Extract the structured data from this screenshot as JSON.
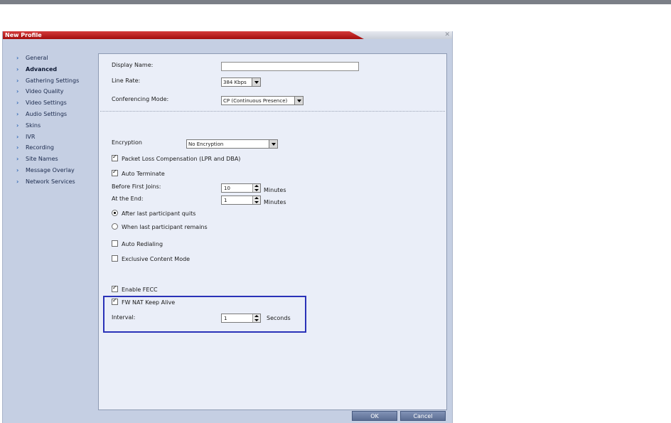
{
  "dialog": {
    "title": "New Profile"
  },
  "nav": {
    "items": [
      {
        "label": "General"
      },
      {
        "label": "Advanced"
      },
      {
        "label": "Gathering Settings"
      },
      {
        "label": "Video Quality"
      },
      {
        "label": "Video Settings"
      },
      {
        "label": "Audio Settings"
      },
      {
        "label": "Skins"
      },
      {
        "label": "IVR"
      },
      {
        "label": "Recording"
      },
      {
        "label": "Site Names"
      },
      {
        "label": "Message Overlay"
      },
      {
        "label": "Network Services"
      }
    ],
    "active": "Advanced"
  },
  "form": {
    "display_name": {
      "label": "Display Name:",
      "value": ""
    },
    "line_rate": {
      "label": "Line Rate:",
      "value": "384 Kbps"
    },
    "conferencing_mode": {
      "label": "Conferencing Mode:",
      "value": "CP (Continuous Presence)"
    },
    "encryption": {
      "label": "Encryption",
      "value": "No Encryption"
    },
    "packet_loss": {
      "label": "Packet Loss Compensation (LPR and DBA)",
      "checked": true
    },
    "auto_terminate": {
      "label": "Auto Terminate",
      "checked": true
    },
    "before_first_joins": {
      "label": "Before First Joins:",
      "value": "10",
      "unit": "Minutes"
    },
    "at_the_end": {
      "label": "At the End:",
      "value": "1",
      "unit": "Minutes"
    },
    "after_last_quits": {
      "label": "After last participant quits",
      "selected": true
    },
    "when_last_remains": {
      "label": "When last participant remains",
      "selected": false
    },
    "auto_redialing": {
      "label": "Auto Redialing",
      "checked": false
    },
    "exclusive_content": {
      "label": "Exclusive Content Mode",
      "checked": false
    },
    "enable_fecc": {
      "label": "Enable FECC",
      "checked": true
    },
    "fw_nat": {
      "label": "FW NAT Keep Alive",
      "checked": true
    },
    "interval": {
      "label": "Interval:",
      "value": "1",
      "unit": "Seconds"
    }
  },
  "footer": {
    "ok_label": "OK",
    "cancel_label": "Cancel"
  },
  "colors": {
    "title_red": "#b81a1a",
    "highlight": "#2a32b8",
    "dialog_bg": "#c5cfe3",
    "panel_bg": "#eaeef8"
  }
}
